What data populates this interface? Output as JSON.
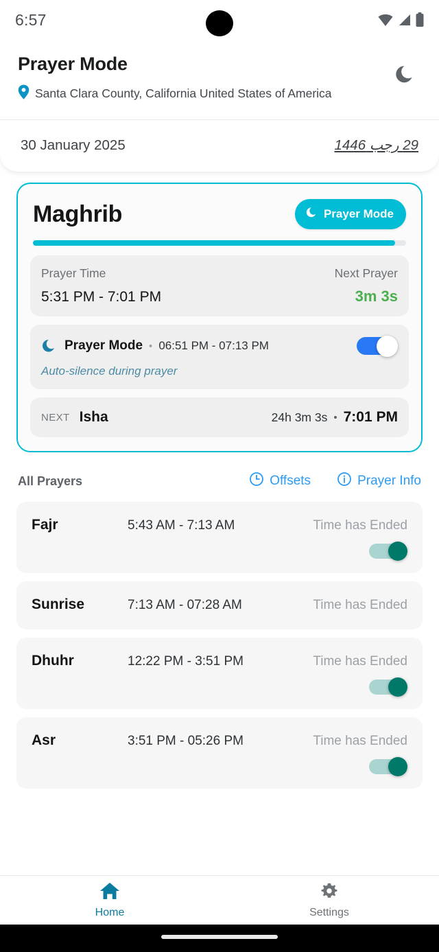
{
  "status_bar": {
    "time": "6:57",
    "icons": [
      "wifi-icon",
      "cellular-signal-icon",
      "battery-icon"
    ]
  },
  "header": {
    "title": "Prayer Mode",
    "location": "Santa Clara County, California United States of America",
    "location_icon": "map-pin-icon",
    "moon_icon": "moon-icon"
  },
  "date_card": {
    "gregorian": "30 January 2025",
    "hijri": "29 رجب 1446"
  },
  "current_card": {
    "prayer_name": "Maghrib",
    "chip_label": "Prayer Mode",
    "chip_icon": "moon-icon",
    "progress_percent": 97,
    "prayer_time_label": "Prayer Time",
    "prayer_time_value": "5:31 PM - 7:01 PM",
    "next_prayer_label": "Next Prayer",
    "next_prayer_countdown": "3m 3s",
    "prayer_mode": {
      "icon": "moon-icon",
      "title": "Prayer Mode",
      "separator": "•",
      "window": "06:51 PM - 07:13 PM",
      "subtitle": "Auto-silence during prayer",
      "toggle_on": true
    },
    "next_row": {
      "kicker": "NEXT",
      "name": "Isha",
      "countdown": "24h 3m 3s",
      "separator": "•",
      "time": "7:01 PM"
    }
  },
  "list_header": {
    "title": "All Prayers",
    "offsets_label": "Offsets",
    "offsets_icon": "clock-icon",
    "prayer_info_label": "Prayer Info",
    "prayer_info_icon": "info-icon"
  },
  "prayers": [
    {
      "name": "Fajr",
      "time": "5:43 AM - 7:13 AM",
      "status": "Time has Ended",
      "has_toggle": true,
      "toggle_on": true
    },
    {
      "name": "Sunrise",
      "time": "7:13 AM - 07:28 AM",
      "status": "Time has Ended",
      "has_toggle": false,
      "toggle_on": false
    },
    {
      "name": "Dhuhr",
      "time": "12:22 PM - 3:51 PM",
      "status": "Time has Ended",
      "has_toggle": true,
      "toggle_on": true
    },
    {
      "name": "Asr",
      "time": "3:51 PM - 05:26 PM",
      "status": "Time has Ended",
      "has_toggle": true,
      "toggle_on": true
    }
  ],
  "bottom_nav": {
    "items": [
      {
        "label": "Home",
        "icon": "home-icon",
        "active": true
      },
      {
        "label": "Settings",
        "icon": "gear-icon",
        "active": false
      }
    ]
  },
  "colors": {
    "accent_teal": "#00bcd4",
    "link_blue": "#2b9bf4",
    "toggle_blue": "#2979f5",
    "toggle_teal": "#00796b",
    "countdown_green": "#4caf50",
    "nav_active": "#0b7ca0"
  }
}
